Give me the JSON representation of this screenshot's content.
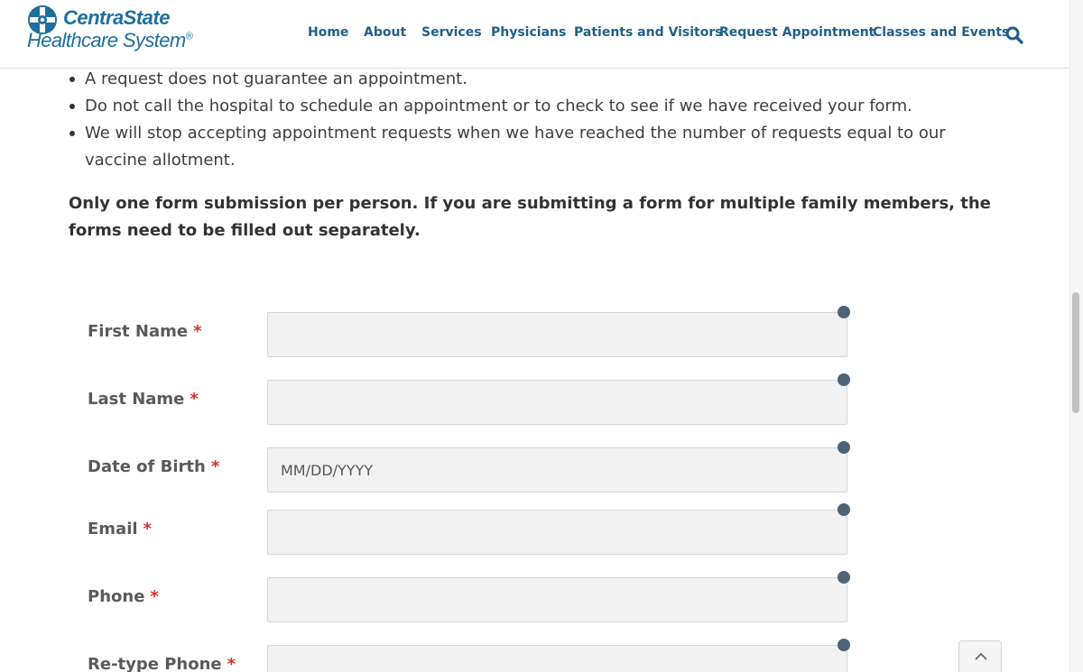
{
  "brand": {
    "name_line1": "CentraState",
    "name_line2": "Healthcare System",
    "reg_mark": "®",
    "icon": "centrastate-cross-logo"
  },
  "nav": {
    "items": [
      {
        "label": "Home"
      },
      {
        "label": "About"
      },
      {
        "label": "Services"
      },
      {
        "label": "Physicians"
      },
      {
        "label": "Patients and Visitors"
      },
      {
        "label": "Request Appointment"
      },
      {
        "label": "Classes and Events"
      }
    ],
    "search_icon": "search-icon"
  },
  "content": {
    "bullets": [
      "A request does not guarantee an appointment.",
      "Do not call the hospital to schedule an appointment or to check to see if we have received your form.",
      "We will stop accepting appointment requests when we have reached the number of requests equal to our vaccine allotment."
    ],
    "notice": "Only one form submission per person. If you are submitting a form for multiple family members, the forms need to be filled out separately."
  },
  "form": {
    "required_marker": "*",
    "fields": [
      {
        "label": "First Name",
        "value": "",
        "placeholder": ""
      },
      {
        "label": "Last Name",
        "value": "",
        "placeholder": ""
      },
      {
        "label": "Date of Birth",
        "value": "",
        "placeholder": "MM/DD/YYYY"
      },
      {
        "label": "Email",
        "value": "",
        "placeholder": ""
      },
      {
        "label": "Phone",
        "value": "",
        "placeholder": ""
      },
      {
        "label": "Re-type Phone",
        "value": "",
        "placeholder": ""
      }
    ]
  },
  "colors": {
    "nav_text": "#1f5f88",
    "brand": "#1d6f9d",
    "required": "#d0352c",
    "field_indicator": "#4b6479"
  },
  "back_to_top_icon": "chevron-up-icon"
}
